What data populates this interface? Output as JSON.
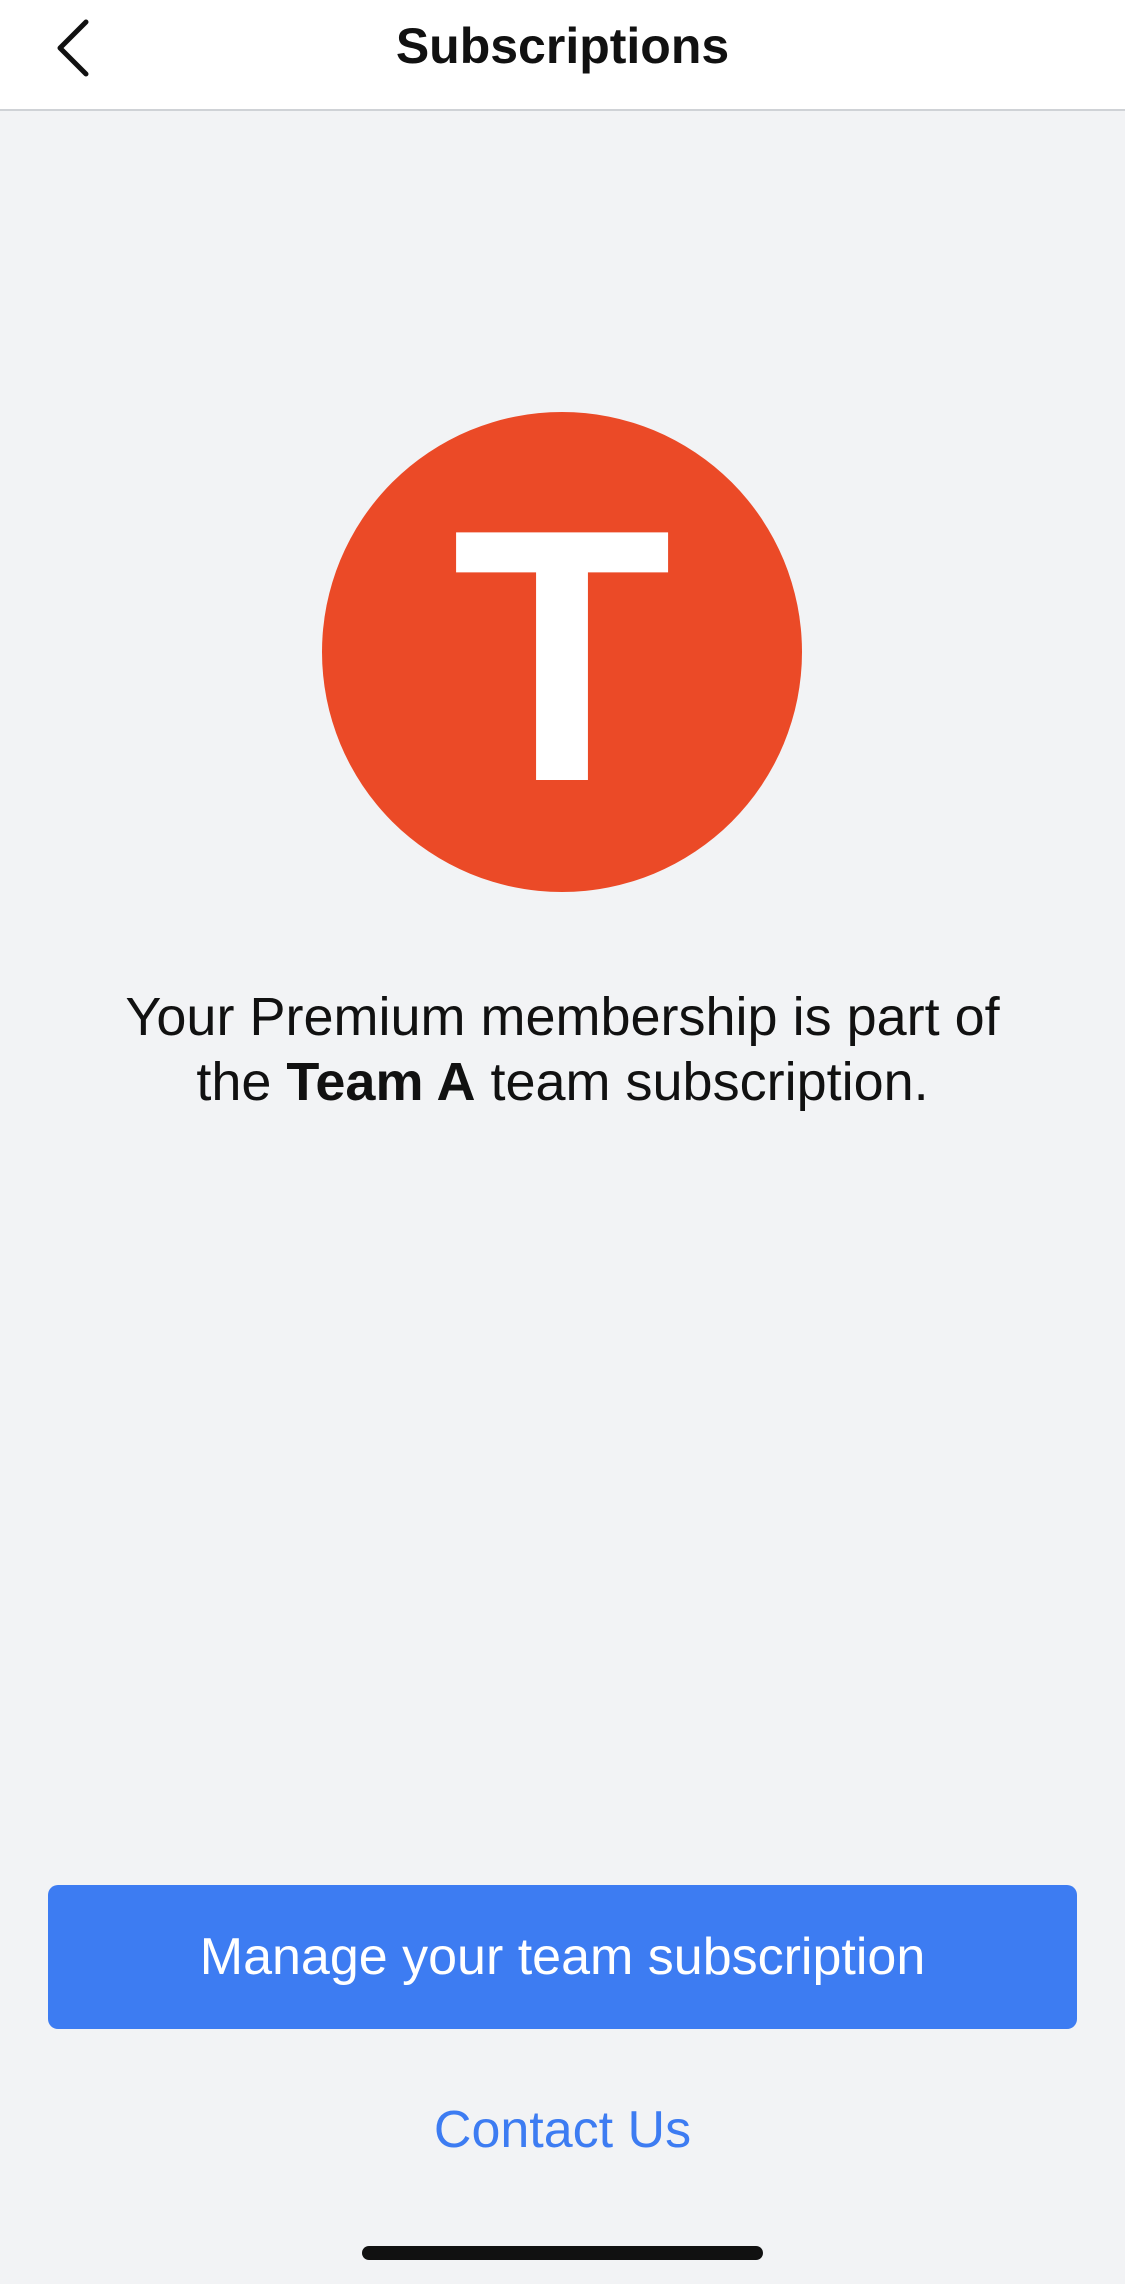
{
  "header": {
    "title": "Subscriptions",
    "back_icon": "chevron-left-icon"
  },
  "team_avatar": {
    "letter": "T",
    "color": "#eb4a27"
  },
  "membership_message": {
    "prefix": "Your Premium membership is part of the ",
    "team_name": "Team A",
    "suffix": " team subscription."
  },
  "actions": {
    "manage_label": "Manage your team subscription",
    "contact_label": "Contact Us",
    "accent_color": "#3d7cf2"
  }
}
